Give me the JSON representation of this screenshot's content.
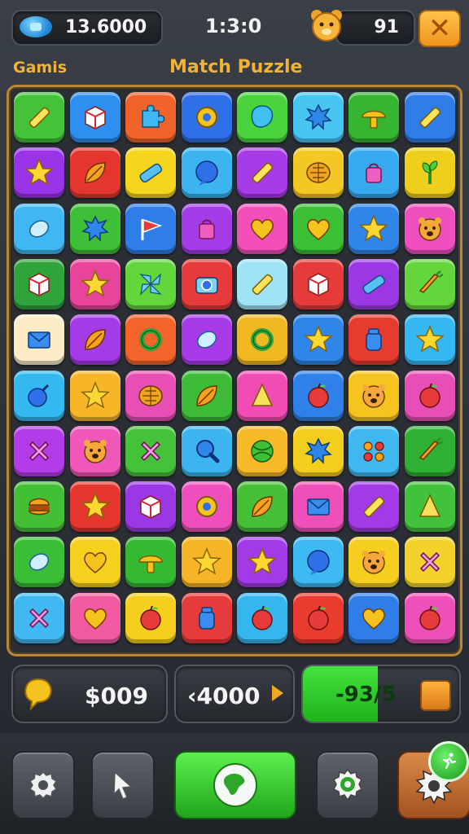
{
  "header": {
    "coins": "13.6000",
    "timer": "1:3:0",
    "lives": "91",
    "close_glyph": "✕",
    "label_left": "Gamis",
    "title": "Match Puzzle"
  },
  "board": {
    "columns": 8,
    "rows": 10,
    "tiles": [
      {
        "color": "#43c23a",
        "icon": "pencil"
      },
      {
        "color": "#2f8ff0",
        "icon": "box"
      },
      {
        "color": "#f0632a",
        "icon": "puzzle"
      },
      {
        "color": "#2f6fe8",
        "icon": "gear"
      },
      {
        "color": "#4bd33e",
        "icon": "blob"
      },
      {
        "color": "#47c6f2",
        "icon": "splat"
      },
      {
        "color": "#36b532",
        "icon": "mushroom"
      },
      {
        "color": "#2f7ee8",
        "icon": "pencil"
      },
      {
        "color": "#9a34e8",
        "icon": "star"
      },
      {
        "color": "#e5362e",
        "icon": "leaf"
      },
      {
        "color": "#f6d51d",
        "icon": "eraser"
      },
      {
        "color": "#3bb4f0",
        "icon": "bubble"
      },
      {
        "color": "#a83be8",
        "icon": "pencil"
      },
      {
        "color": "#f3c724",
        "icon": "shell"
      },
      {
        "color": "#37a9ef",
        "icon": "bag"
      },
      {
        "color": "#f0cf1c",
        "icon": "sprout"
      },
      {
        "color": "#3fb7f2",
        "icon": "gem"
      },
      {
        "color": "#3fbe37",
        "icon": "splat"
      },
      {
        "color": "#2f7ee8",
        "icon": "flag"
      },
      {
        "color": "#a33be6",
        "icon": "bag"
      },
      {
        "color": "#f24fb8",
        "icon": "heart"
      },
      {
        "color": "#3bbf35",
        "icon": "heart"
      },
      {
        "color": "#2f86e8",
        "icon": "star"
      },
      {
        "color": "#ef4fbf",
        "icon": "face"
      },
      {
        "color": "#2ea43a",
        "icon": "box"
      },
      {
        "color": "#e8459a",
        "icon": "star"
      },
      {
        "color": "#62d63a",
        "icon": "pinwheel"
      },
      {
        "color": "#e73a3a",
        "icon": "camera"
      },
      {
        "color": "#9fe4f6",
        "icon": "pencil"
      },
      {
        "color": "#e63b3b",
        "icon": "box"
      },
      {
        "color": "#9b38e4",
        "icon": "eraser"
      },
      {
        "color": "#64d63c",
        "icon": "carrot"
      },
      {
        "color": "#fbecc7",
        "icon": "envelope"
      },
      {
        "color": "#a53be6",
        "icon": "leaf"
      },
      {
        "color": "#f2642a",
        "icon": "ring"
      },
      {
        "color": "#a83be8",
        "icon": "gem"
      },
      {
        "color": "#f2b822",
        "icon": "ring"
      },
      {
        "color": "#2f86e8",
        "icon": "star"
      },
      {
        "color": "#e63b2f",
        "icon": "jar"
      },
      {
        "color": "#35b7f2",
        "icon": "star"
      },
      {
        "color": "#33b9f0",
        "icon": "bomb"
      },
      {
        "color": "#f6b628",
        "icon": "star"
      },
      {
        "color": "#e84fb4",
        "icon": "shell"
      },
      {
        "color": "#3dbb38",
        "icon": "leaf"
      },
      {
        "color": "#f14cb4",
        "icon": "cone"
      },
      {
        "color": "#2f80e8",
        "icon": "apple"
      },
      {
        "color": "#f6c31f",
        "icon": "face"
      },
      {
        "color": "#e84fb6",
        "icon": "apple"
      },
      {
        "color": "#b43be8",
        "icon": "cross"
      },
      {
        "color": "#ef58b8",
        "icon": "face"
      },
      {
        "color": "#46c23a",
        "icon": "cross"
      },
      {
        "color": "#3bb4f0",
        "icon": "search"
      },
      {
        "color": "#f6b928",
        "icon": "ball"
      },
      {
        "color": "#f2cf1e",
        "icon": "splat"
      },
      {
        "color": "#3fb8ef",
        "icon": "dots"
      },
      {
        "color": "#2fb034",
        "icon": "carrot"
      },
      {
        "color": "#43bf36",
        "icon": "burger"
      },
      {
        "color": "#e5362e",
        "icon": "star"
      },
      {
        "color": "#9a38e6",
        "icon": "box"
      },
      {
        "color": "#ee4fbd",
        "icon": "gear"
      },
      {
        "color": "#46bf37",
        "icon": "leaf"
      },
      {
        "color": "#ef4fb8",
        "icon": "envelope"
      },
      {
        "color": "#a23be7",
        "icon": "pencil"
      },
      {
        "color": "#42c23a",
        "icon": "cone"
      },
      {
        "color": "#3bbd36",
        "icon": "gem"
      },
      {
        "color": "#f6d01f",
        "icon": "heart"
      },
      {
        "color": "#35b832",
        "icon": "mushroom"
      },
      {
        "color": "#f5b526",
        "icon": "star"
      },
      {
        "color": "#a23be7",
        "icon": "star"
      },
      {
        "color": "#3db9f2",
        "icon": "bubble"
      },
      {
        "color": "#f6ce1f",
        "icon": "face"
      },
      {
        "color": "#f2d22a",
        "icon": "cross"
      },
      {
        "color": "#40b9f2",
        "icon": "cross"
      },
      {
        "color": "#f05aa0",
        "icon": "heart"
      },
      {
        "color": "#f6cf1e",
        "icon": "apple"
      },
      {
        "color": "#e63b3b",
        "icon": "jar"
      },
      {
        "color": "#36b6ef",
        "icon": "apple"
      },
      {
        "color": "#ea3b2f",
        "icon": "apple"
      },
      {
        "color": "#2f7ee8",
        "icon": "heart"
      },
      {
        "color": "#ef4fb8",
        "icon": "apple"
      }
    ]
  },
  "counters": {
    "money": "$009",
    "score": "‹4000",
    "progress_text": "-93/5",
    "progress_fraction": 0.48
  },
  "nav": {
    "items": [
      "settings-gear-icon",
      "pointer-icon",
      "play-globe-icon",
      "target-gear-icon",
      "spiked-gear-icon"
    ]
  }
}
